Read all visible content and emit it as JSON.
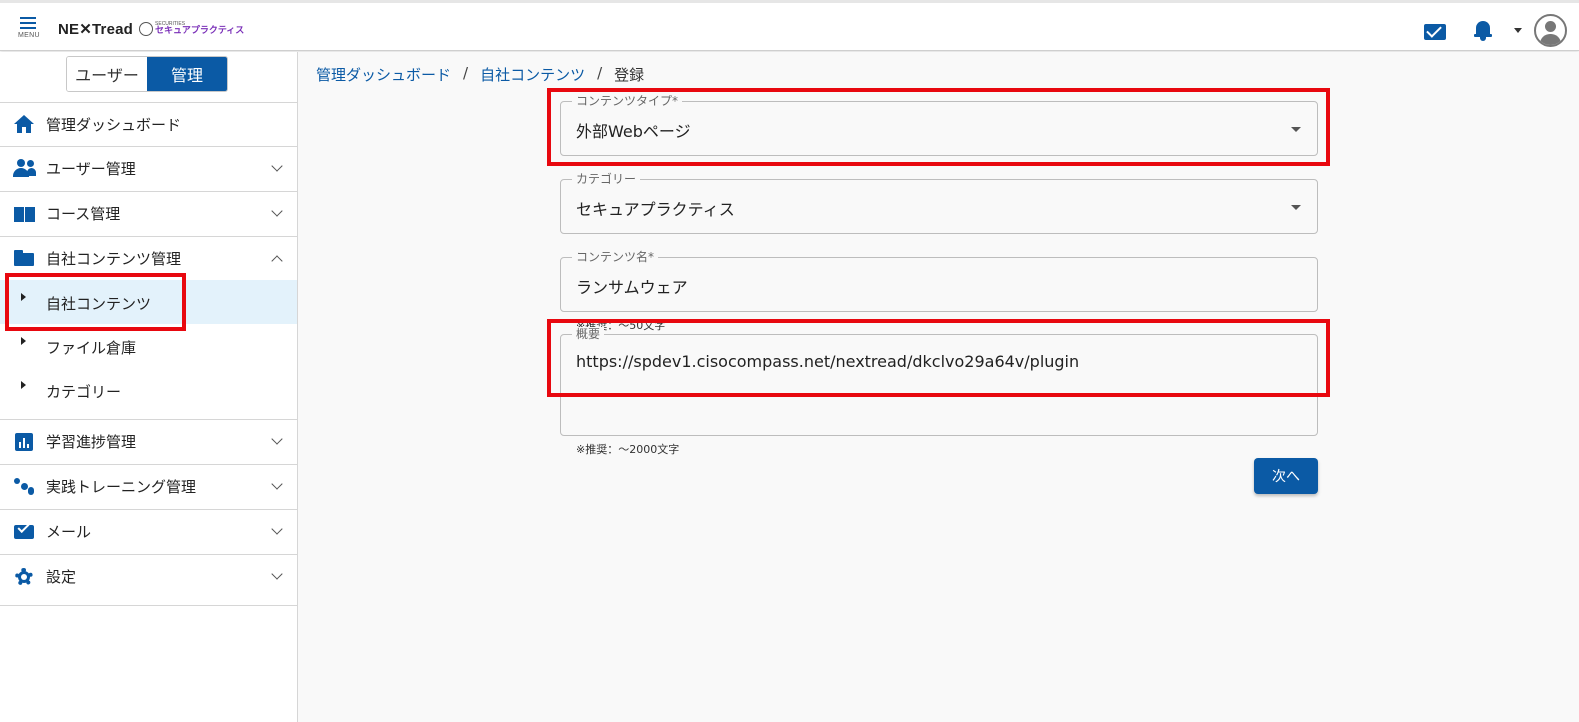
{
  "header": {
    "menu_label": "MENU",
    "logo_main": "NE✕Tread",
    "logo_sub_small": "SECURITIES",
    "logo_sub": "セキュアプラクティス",
    "icons": [
      "hamburger-menu-icon",
      "mail-icon",
      "bell-icon",
      "caret-down-icon",
      "user-avatar-icon"
    ]
  },
  "sidebar": {
    "toggle": {
      "user": "ユーザー",
      "admin": "管理"
    },
    "items": [
      {
        "label": "管理ダッシュボード",
        "icon": "home-icon"
      },
      {
        "label": "ユーザー管理",
        "icon": "people-icon"
      },
      {
        "label": "コース管理",
        "icon": "book-icon"
      },
      {
        "label": "自社コンテンツ管理",
        "icon": "folder-icon"
      },
      {
        "label": "学習進捗管理",
        "icon": "bar-chart-icon"
      },
      {
        "label": "実践トレーニング管理",
        "icon": "training-icon"
      },
      {
        "label": "メール",
        "icon": "mail-icon"
      },
      {
        "label": "設定",
        "icon": "gear-icon"
      }
    ],
    "subitems": [
      {
        "label": "自社コンテンツ"
      },
      {
        "label": "ファイル倉庫"
      },
      {
        "label": "カテゴリー"
      }
    ]
  },
  "breadcrumb": {
    "items": [
      "管理ダッシュボード",
      "自社コンテンツ"
    ],
    "current": "登録",
    "separator": "/"
  },
  "form": {
    "content_type": {
      "label": "コンテンツタイプ*",
      "value": "外部Webページ"
    },
    "category": {
      "label": "カテゴリー",
      "value": "セキュアプラクティス"
    },
    "content_name": {
      "label": "コンテンツ名*",
      "value": "ランサムウェア",
      "hint": "※推奨：～50文字"
    },
    "summary": {
      "label": "概要",
      "value": "https://spdev1.cisocompass.net/nextread/dkclvo29a64v/plugin",
      "hint": "※推奨：～2000文字"
    },
    "next_label": "次へ"
  },
  "colors": {
    "primary": "#0b5aa5",
    "annotation_red": "#e8080f",
    "active_bg": "#e3f2fb"
  }
}
